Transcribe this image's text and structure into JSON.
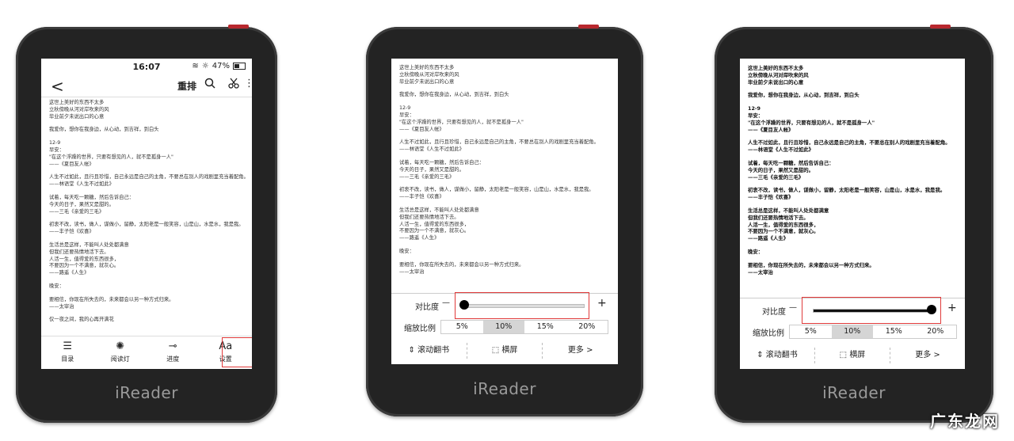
{
  "brand": "iReader",
  "status": {
    "time": "16:07",
    "battery": "47%"
  },
  "toolbar": {
    "back": "<",
    "rearrange": "重排",
    "search_icon": "search-icon",
    "scissors_icon": "scissors-icon",
    "more": "⋮"
  },
  "text_lines": [
    "这世上美好的东西不太多",
    "立秋傍晚从河对岸吹来的风",
    "毕业前夕未说出口的心意",
    "",
    "我爱你，想你在我身边，从心动，到吉祥，到白头",
    "",
    "12-9",
    "早安：",
    "\"在这个浮躁的世界，只要有想见的人，就不是孤身一人\"",
    "——《夏目友人帐》",
    "",
    "人生不过如此，且行且珍惜，自己永远是自己的主角，不要总在别人的戏剧里充当着配角。",
    "——林语堂《人生不过如此》",
    "",
    "试着，每天吃一颗糖，然后告诉自己：",
    "今天的日子，果然又是甜的。",
    "——三毛《亲爱的三毛》",
    "",
    "初衷不改，读书，做人，谋做小，留静，太阳老是一般笑容，山是山，水是水，我是我。",
    "——丰子恺《欢喜》",
    "",
    "生活总是这样，不能叫人处处都满意",
    "但我们还要热情地活下去。",
    "人活一生，值得爱的东西很多，",
    "不要因为一个不满意，就灰心。",
    "——路遥《人生》",
    "",
    "晚安：",
    "",
    "要相信，你现在所失去的，未来都会以另一种方式归来。",
    "——太宰治",
    "",
    "仅一夜之间，我的心再开满花"
  ],
  "bottom_nav": [
    {
      "label": "目录",
      "icon": "list-icon"
    },
    {
      "label": "阅读灯",
      "icon": "light-icon"
    },
    {
      "label": "进度",
      "icon": "progress-icon"
    },
    {
      "label": "设置",
      "icon": "font-settings-icon"
    }
  ],
  "settings": {
    "contrast_label": "对比度",
    "minus": "—",
    "plus": "+",
    "zoom_label": "缩放比例",
    "zoom_options": [
      "5%",
      "10%",
      "15%",
      "20%"
    ],
    "zoom_selected": "10%",
    "contrast_level_device2": 0.0,
    "contrast_level_device3": 1.0,
    "scroll_label": "滚动翻书",
    "landscape_label": "横屏",
    "more_label": "更多 >"
  },
  "watermark": "广东龙网"
}
